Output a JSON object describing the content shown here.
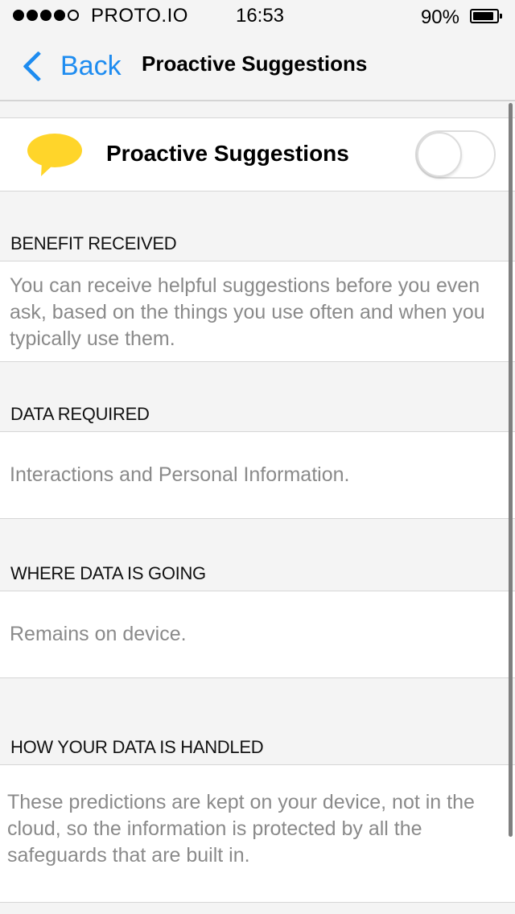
{
  "status_bar": {
    "signal_dots_filled": 4,
    "signal_dots_total": 5,
    "carrier": "PROTO.IO",
    "time": "16:53",
    "battery_percent_label": "90%",
    "battery_level": 0.9
  },
  "nav": {
    "back_label": "Back",
    "title": "Proactive Suggestions",
    "back_icon": "chevron-left-icon"
  },
  "toggle_row": {
    "icon": "speech-bubble-icon",
    "icon_color": "#ffd52a",
    "label": "Proactive Suggestions",
    "enabled": false
  },
  "sections": [
    {
      "header": "BENEFIT RECEIVED",
      "body": "You can receive helpful suggestions before you even ask, based on the things you use often and when you typically use them."
    },
    {
      "header": "DATA REQUIRED",
      "body": "Interactions and Personal Information."
    },
    {
      "header": "WHERE DATA IS GOING",
      "body": "Remains on device."
    },
    {
      "header": "HOW YOUR DATA IS HANDLED",
      "body": "These predictions are kept on your device, not in the cloud, so the information is protected by all the safeguards that are built in."
    }
  ],
  "colors": {
    "accent": "#1e8cf0",
    "background": "#f4f4f4",
    "body_text": "#8a8a8a"
  }
}
